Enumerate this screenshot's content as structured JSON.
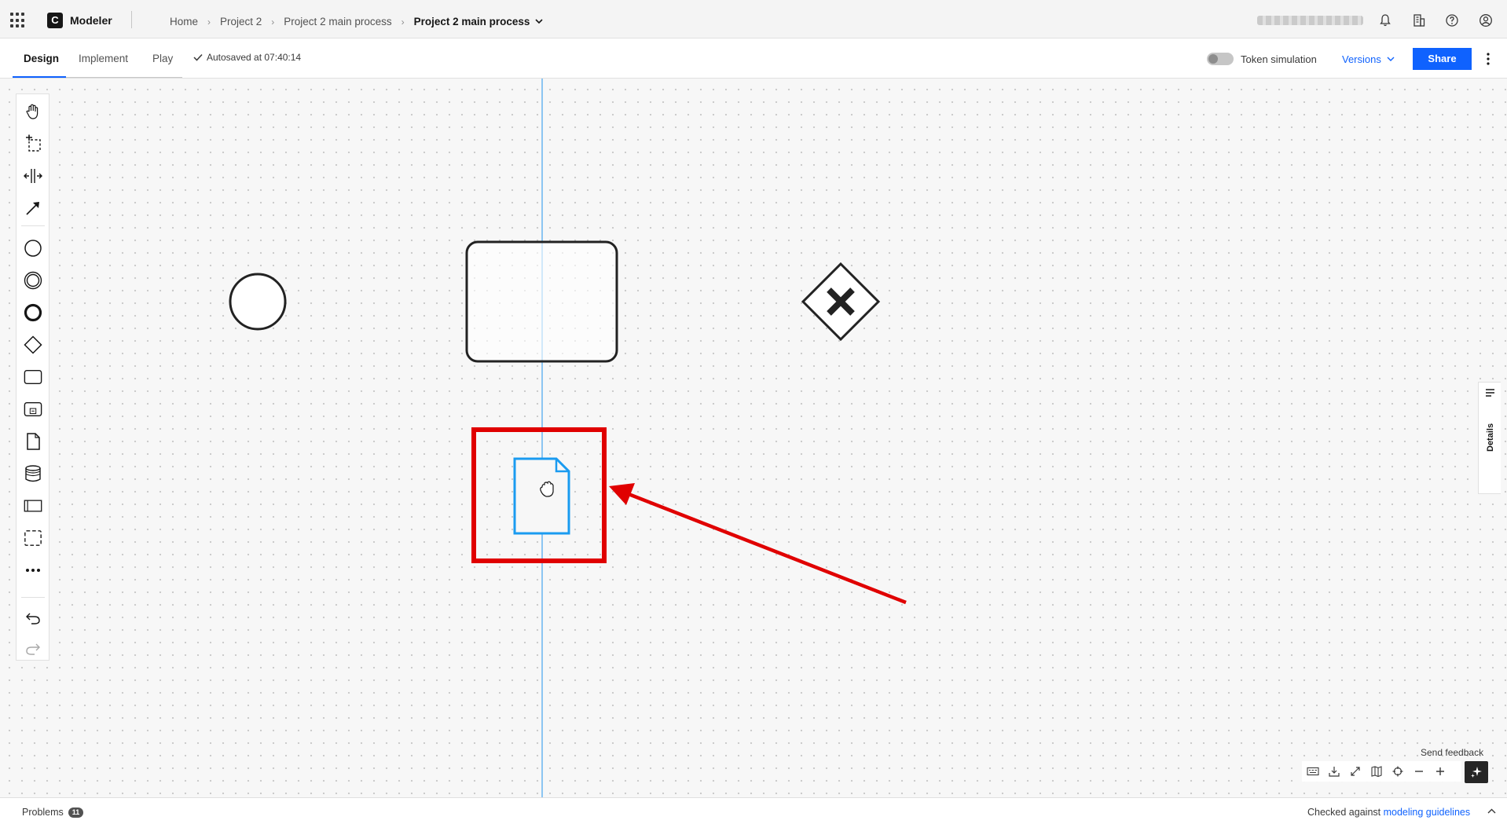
{
  "header": {
    "app_name": "Modeler",
    "logo_letter": "C",
    "breadcrumbs": [
      "Home",
      "Project 2",
      "Project 2 main process"
    ],
    "current_item": "Project 2 main process",
    "icons": [
      "app-switcher-icon",
      "notification-bell-icon",
      "organization-icon",
      "help-icon",
      "user-profile-icon"
    ]
  },
  "tabs": [
    {
      "label": "Design",
      "active": true
    },
    {
      "label": "Implement",
      "active": false
    },
    {
      "label": "Play",
      "active": false
    }
  ],
  "autosave_text": "Autosaved at 07:40:14",
  "token_simulation": {
    "label": "Token simulation",
    "enabled": false
  },
  "versions_label": "Versions",
  "share_label": "Share",
  "palette": {
    "tools": [
      "hand-tool-icon",
      "lasso-tool-icon",
      "space-tool-icon",
      "global-connect-tool-icon",
      "start-event-icon",
      "intermediate-event-icon",
      "end-event-icon",
      "gateway-icon",
      "task-icon",
      "subprocess-icon",
      "data-object-icon",
      "data-store-icon",
      "pool-icon",
      "group-icon",
      "more-icon"
    ],
    "history": [
      "undo-icon",
      "redo-icon"
    ]
  },
  "diagram": {
    "elements": [
      "start-event",
      "task",
      "exclusive-gateway",
      "data-object"
    ],
    "gateway_marker": "X",
    "selected_element": "data-object",
    "highlight_color": "#e00000",
    "selection_color": "#1a9bf0"
  },
  "details_label": "Details",
  "feedback_label": "Send feedback",
  "canvas_controls": [
    "keyboard-icon",
    "download-icon",
    "fullscreen-icon",
    "minimap-icon",
    "reset-view-icon",
    "zoom-out-icon",
    "zoom-in-icon"
  ],
  "ai_button": "ai-sparkle-icon",
  "bottom": {
    "problems_label": "Problems",
    "problems_count": "11",
    "checked_text": "Checked against",
    "guidelines_link": "modeling guidelines"
  },
  "colors": {
    "primary": "#0f62fe",
    "alert": "#e00000",
    "selection": "#1a9bf0"
  }
}
